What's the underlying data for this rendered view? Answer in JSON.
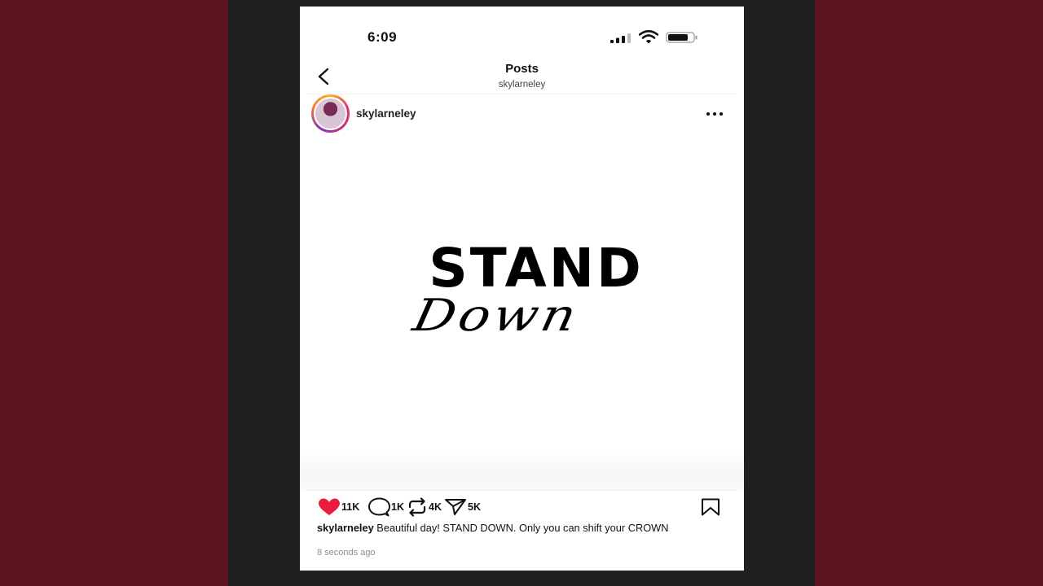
{
  "status_bar": {
    "time": "6:09",
    "icons": [
      "signal-icon",
      "wifi-icon",
      "battery-icon"
    ]
  },
  "header": {
    "title": "Posts",
    "subtitle": "skylarneley",
    "back_icon": "chevron-left-icon"
  },
  "post": {
    "username": "skylarneley",
    "more_icon": "more-horizontal-icon",
    "image_text": {
      "line1": "STAND",
      "line2": "Down"
    },
    "actions": {
      "likes": "11K",
      "comments": "1K",
      "reposts": "4K",
      "shares": "5K",
      "like_color": "#ed1c3e"
    },
    "caption_user": "skylarneley",
    "caption_text": " Beautiful day! STAND DOWN. Only you can shift your CROWN",
    "timestamp": "8 seconds ago"
  },
  "colors": {
    "outer_background": "#5c141e",
    "panel_background": "#202020",
    "phone_background": "#ffffff"
  }
}
